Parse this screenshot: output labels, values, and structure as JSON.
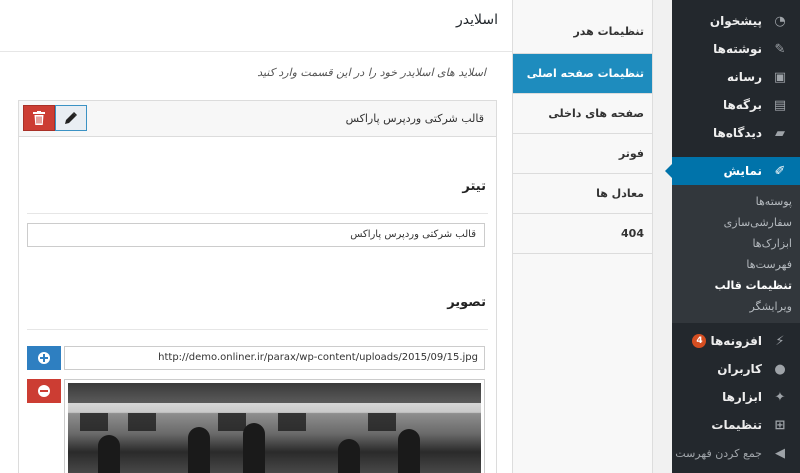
{
  "sidebar": {
    "items": [
      {
        "label": "پیشخوان",
        "icon": "dashboard-icon"
      },
      {
        "label": "نوشته‌ها",
        "icon": "pin-icon"
      },
      {
        "label": "رسانه",
        "icon": "media-icon"
      },
      {
        "label": "برگه‌ها",
        "icon": "pages-icon"
      },
      {
        "label": "دیدگاه‌ها",
        "icon": "comments-icon"
      },
      {
        "label": "نمایش",
        "icon": "appearance-icon"
      }
    ],
    "submenu": [
      "پوسته‌ها",
      "سفارشی‌سازی",
      "ابزارک‌ها",
      "فهرست‌ها",
      "تنظیمات قالب",
      "ویرایشگر"
    ],
    "items_after": [
      {
        "label": "افزونه‌ها",
        "icon": "plugins-icon",
        "badge": "4"
      },
      {
        "label": "کاربران",
        "icon": "users-icon"
      },
      {
        "label": "ابزارها",
        "icon": "tools-icon"
      },
      {
        "label": "تنظیمات",
        "icon": "settings-icon"
      }
    ],
    "collapse": "جمع کردن فهرست"
  },
  "tabs": [
    "تنظیمات هدر",
    "تنظیمات صفحه اصلی",
    "صفحه های داخلی",
    "فوتر",
    "معادل ها",
    "404"
  ],
  "main": {
    "section_title": "اسلایدر",
    "section_description": "اسلاید های اسلایدر خود را در این قسمت وارد کنید",
    "slide": {
      "header_title": "قالب شرکتی وردپرس پاراکس",
      "title_label": "تیتر",
      "title_value": "قالب شرکتی وردپرس پاراکس",
      "image_label": "تصویر",
      "image_url": "http://demo.onliner.ir/parax/wp-content/uploads/2015/09/15.jpg"
    }
  },
  "colors": {
    "accent": "#0073aa",
    "danger": "#cc3d33",
    "sidebar": "#23282d"
  }
}
